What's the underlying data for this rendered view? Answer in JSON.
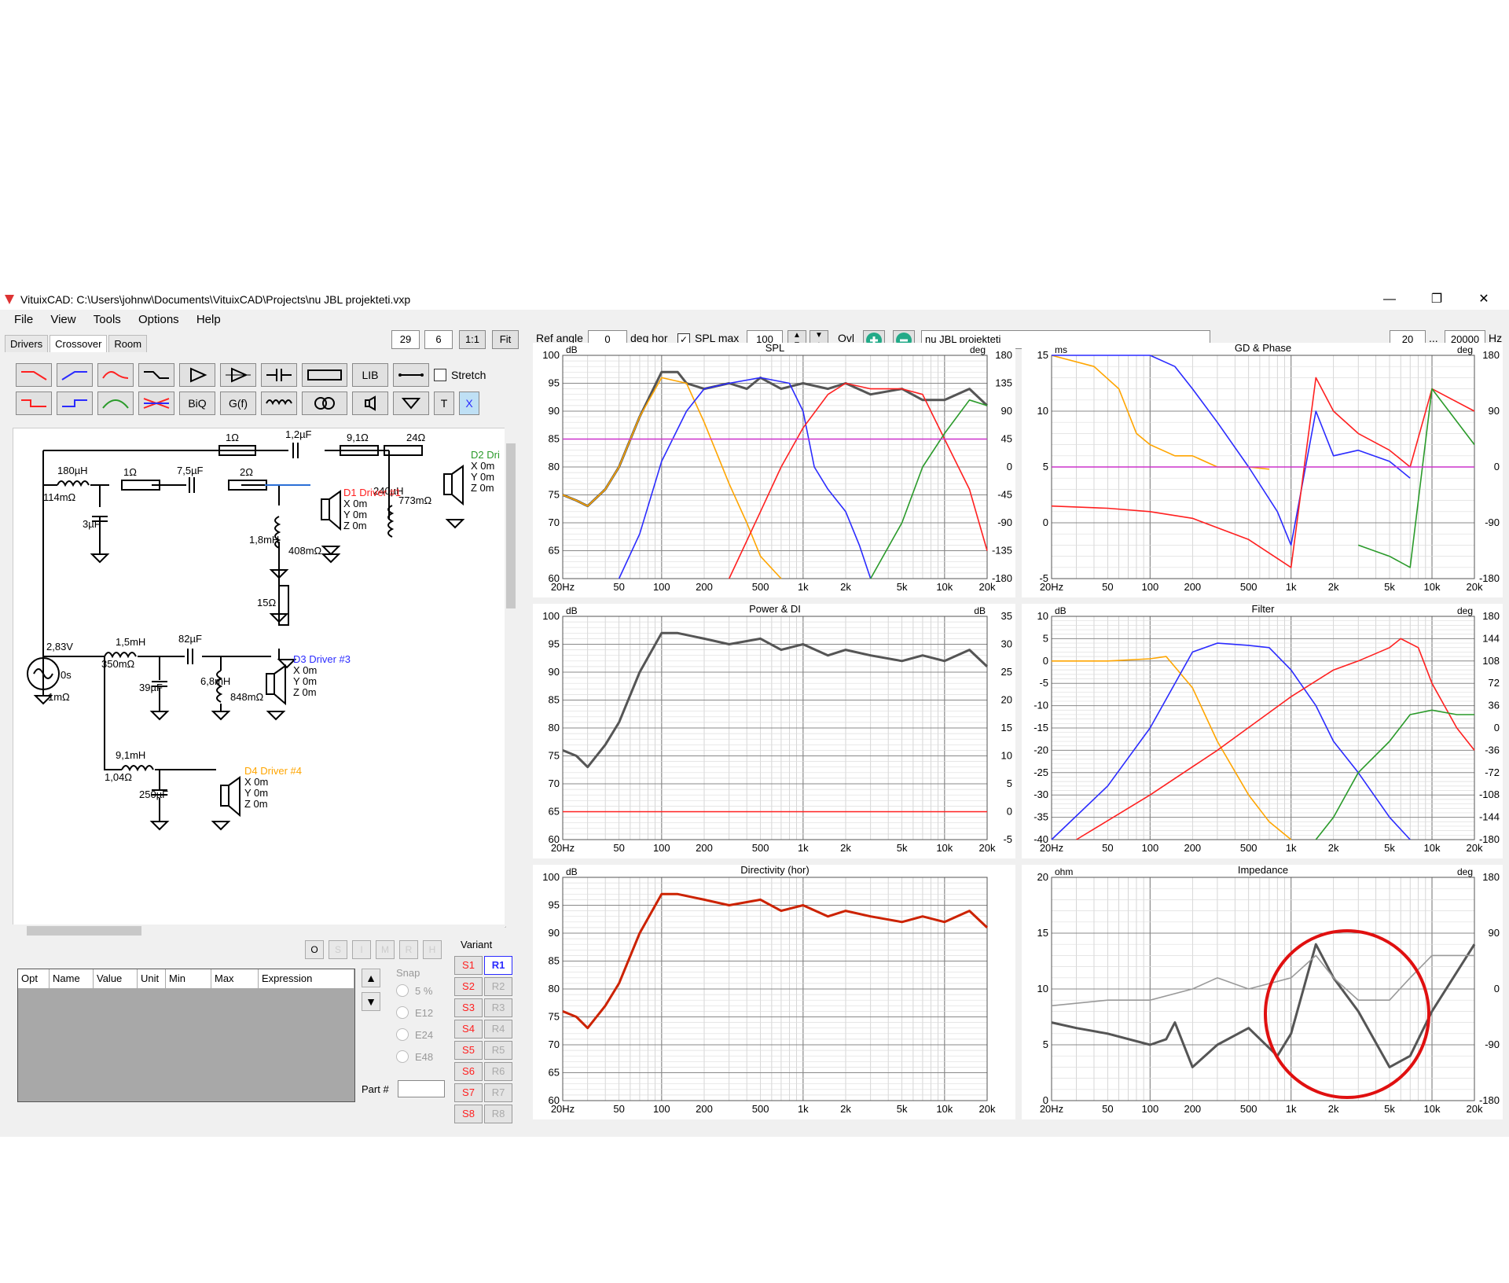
{
  "window": {
    "title": "VituixCAD: C:\\Users\\johnw\\Documents\\VituixCAD\\Projects\\nu JBL projekteti.vxp",
    "minimize": "—",
    "restore": "❐",
    "close": "✕"
  },
  "menu": {
    "file": "File",
    "view": "View",
    "tools": "Tools",
    "options": "Options",
    "help": "Help"
  },
  "tabs": {
    "drivers": "Drivers",
    "crossover": "Crossover",
    "room": "Room"
  },
  "zoom": {
    "a": "29",
    "b": "6",
    "one": "1:1",
    "fit": "Fit"
  },
  "toolbar": {
    "lib": "LIB",
    "biq": "BiQ",
    "gf": "G(f)",
    "t": "T",
    "x": "X",
    "stretch": "Stretch"
  },
  "top_controls": {
    "ref_angle_label": "Ref angle",
    "ref_angle_value": "0",
    "deg_hor": "deg hor",
    "spl_max_label": "SPL max",
    "spl_max_value": "100",
    "ovl": "Ovl",
    "project_name": "nu JBL projekteti",
    "freq_min": "20",
    "ellipsis": "...",
    "freq_max": "20000",
    "hz": "Hz"
  },
  "schematic": {
    "r_top1": "1Ω",
    "c_top": "1,2µF",
    "r_top2": "9,1Ω",
    "r_top3": "24Ω",
    "d2": "D2 Dri",
    "d2x": "X 0m",
    "d2y": "Y 0m",
    "d2z": "Z 0m",
    "l1": "180µH",
    "l1r": "114mΩ",
    "r1": "1Ω",
    "c1": "7,5µF",
    "r2": "2Ω",
    "lp": "240µH",
    "lpr": "773mΩ",
    "c3": "3µF",
    "d1": "D1 Driver #1",
    "d1x": "X 0m",
    "d1y": "Y 0m",
    "d1z": "Z 0m",
    "l2": "1,8mH",
    "l2r": "408mΩ",
    "r15": "15Ω",
    "src_v": "2,83V",
    "src_t": "0s",
    "src_r": "1mΩ",
    "l3": "1,5mH",
    "l3r": "350mΩ",
    "c82": "82µF",
    "c39": "39µF",
    "l4": "6,8mH",
    "l4r": "848mΩ",
    "d3": "D3 Driver #3",
    "d3x": "X 0m",
    "d3y": "Y 0m",
    "d3z": "Z 0m",
    "l5": "9,1mH",
    "l5r": "1,04Ω",
    "c250": "250µF",
    "d4": "D4 Driver #4",
    "d4x": "X 0m",
    "d4y": "Y 0m",
    "d4z": "Z 0m"
  },
  "opt_buttons": [
    "O",
    "S",
    "I",
    "M",
    "R",
    "H"
  ],
  "opt_table": {
    "headers": [
      "Opt",
      "Name",
      "Value",
      "Unit",
      "Min",
      "Max",
      "Expression"
    ]
  },
  "snap": {
    "label": "Snap",
    "options": [
      "5 %",
      "E12",
      "E24",
      "E48"
    ],
    "part_label": "Part #"
  },
  "variant": {
    "label": "Variant",
    "s": [
      "S1",
      "S2",
      "S3",
      "S4",
      "S5",
      "S6",
      "S7",
      "S8"
    ],
    "r": [
      "R1",
      "R2",
      "R3",
      "R4",
      "R5",
      "R6",
      "R7",
      "R8"
    ]
  },
  "colors": {
    "orange": "#ffa500",
    "blue": "#2b2bff",
    "red": "#ff2020",
    "green": "#2a9a2a",
    "magenta": "#cc33cc",
    "dark": "#555555",
    "darkred": "#cc2200"
  },
  "freq_ticks": [
    "20Hz",
    "50",
    "100",
    "200",
    "500",
    "1k",
    "2k",
    "5k",
    "10k",
    "20k"
  ],
  "charts": {
    "spl": {
      "title": "SPL",
      "left_unit": "dB",
      "right_unit": "deg",
      "left_ticks": [
        "100",
        "95",
        "90",
        "85",
        "80",
        "75",
        "70",
        "65",
        "60"
      ],
      "right_ticks": [
        "180",
        "135",
        "90",
        "45",
        "0",
        "-45",
        "-90",
        "-135",
        "-180"
      ]
    },
    "gd": {
      "title": "GD & Phase",
      "left_unit": "ms",
      "right_unit": "deg",
      "left_ticks": [
        "15",
        "10",
        "5",
        "0",
        "-5"
      ],
      "right_ticks": [
        "180",
        "90",
        "0",
        "-90",
        "-180"
      ]
    },
    "power": {
      "title": "Power & DI",
      "left_unit": "dB",
      "right_unit": "dB",
      "left_ticks": [
        "100",
        "95",
        "90",
        "85",
        "80",
        "75",
        "70",
        "65",
        "60"
      ],
      "right_ticks": [
        "35",
        "30",
        "25",
        "20",
        "15",
        "10",
        "5",
        "0",
        "-5"
      ]
    },
    "filter": {
      "title": "Filter",
      "left_unit": "dB",
      "right_unit": "deg",
      "left_ticks": [
        "10",
        "5",
        "0",
        "-5",
        "-10",
        "-15",
        "-20",
        "-25",
        "-30",
        "-35",
        "-40"
      ],
      "right_ticks": [
        "180",
        "144",
        "108",
        "72",
        "36",
        "0",
        "-36",
        "-72",
        "-108",
        "-144",
        "-180"
      ]
    },
    "directivity": {
      "title": "Directivity (hor)",
      "left_unit": "dB",
      "right_unit": "",
      "left_ticks": [
        "100",
        "95",
        "90",
        "85",
        "80",
        "75",
        "70",
        "65",
        "60"
      ],
      "right_ticks": []
    },
    "impedance": {
      "title": "Impedance",
      "left_unit": "ohm",
      "right_unit": "deg",
      "left_ticks": [
        "20",
        "15",
        "10",
        "5",
        "0"
      ],
      "right_ticks": [
        "180",
        "90",
        "0",
        "-90",
        "-180"
      ]
    }
  },
  "chart_data": [
    {
      "type": "line",
      "title": "SPL",
      "xlabel": "",
      "ylabel": "dB",
      "xscale": "log",
      "xlim": [
        20,
        20000
      ],
      "ylim": [
        60,
        100
      ],
      "series": [
        {
          "color": "#555555",
          "x": [
            20,
            25,
            30,
            40,
            50,
            70,
            100,
            130,
            150,
            200,
            300,
            400,
            500,
            700,
            1000,
            1500,
            2000,
            3000,
            5000,
            7000,
            10000,
            15000,
            20000
          ],
          "y": [
            75,
            74,
            73,
            76,
            80,
            89,
            97,
            97,
            95,
            94,
            95,
            94,
            96,
            94,
            95,
            94,
            95,
            93,
            94,
            92,
            92,
            94,
            91
          ]
        },
        {
          "color": "#ffa500",
          "x": [
            20,
            25,
            30,
            40,
            50,
            70,
            100,
            150,
            200,
            300,
            400,
            500,
            700
          ],
          "y": [
            75,
            74,
            73,
            76,
            80,
            89,
            96,
            95,
            88,
            77,
            70,
            64,
            60
          ]
        },
        {
          "color": "#2b2bff",
          "x": [
            50,
            70,
            100,
            150,
            200,
            300,
            500,
            800,
            1000,
            1200,
            1500,
            2000,
            2500,
            3000
          ],
          "y": [
            60,
            68,
            81,
            90,
            94,
            95,
            96,
            95,
            90,
            80,
            76,
            72,
            66,
            60
          ]
        },
        {
          "color": "#ff2020",
          "x": [
            300,
            500,
            700,
            1000,
            1500,
            2000,
            3000,
            5000,
            7000,
            10000,
            15000,
            20000
          ],
          "y": [
            60,
            72,
            80,
            87,
            93,
            95,
            94,
            94,
            93,
            85,
            76,
            65
          ]
        },
        {
          "color": "#2a9a2a",
          "x": [
            3000,
            5000,
            7000,
            10000,
            15000,
            20000
          ],
          "y": [
            60,
            70,
            80,
            86,
            92,
            91
          ]
        },
        {
          "color": "#cc33cc",
          "x": [
            20,
            20000
          ],
          "y": [
            85,
            85
          ]
        }
      ]
    },
    {
      "type": "line",
      "title": "Power & DI",
      "xlabel": "",
      "ylabel": "dB",
      "xscale": "log",
      "xlim": [
        20,
        20000
      ],
      "ylim": [
        60,
        100
      ],
      "series": [
        {
          "color": "#555555",
          "x": [
            20,
            25,
            30,
            40,
            50,
            70,
            100,
            130,
            200,
            300,
            500,
            700,
            1000,
            1500,
            2000,
            3000,
            5000,
            7000,
            10000,
            15000,
            20000
          ],
          "y": [
            76,
            75,
            73,
            77,
            81,
            90,
            97,
            97,
            96,
            95,
            96,
            94,
            95,
            93,
            94,
            93,
            92,
            93,
            92,
            94,
            91
          ]
        },
        {
          "color": "#ff2020",
          "x": [
            20,
            20000
          ],
          "y": [
            65,
            65
          ]
        }
      ]
    },
    {
      "type": "line",
      "title": "Directivity (hor)",
      "xlabel": "",
      "ylabel": "dB",
      "xscale": "log",
      "xlim": [
        20,
        20000
      ],
      "ylim": [
        60,
        100
      ],
      "series": [
        {
          "color": "#cc2200",
          "x": [
            20,
            25,
            30,
            40,
            50,
            70,
            100,
            130,
            200,
            300,
            500,
            700,
            1000,
            1500,
            2000,
            3000,
            5000,
            7000,
            10000,
            15000,
            20000
          ],
          "y": [
            76,
            75,
            73,
            77,
            81,
            90,
            97,
            97,
            96,
            95,
            96,
            94,
            95,
            93,
            94,
            93,
            92,
            93,
            92,
            94,
            91
          ]
        }
      ]
    },
    {
      "type": "line",
      "title": "GD & Phase",
      "xlabel": "",
      "ylabel": "ms",
      "xscale": "log",
      "xlim": [
        20,
        20000
      ],
      "ylim": [
        -5,
        15
      ],
      "series": [
        {
          "color": "#ffa500",
          "x": [
            20,
            40,
            60,
            80,
            100,
            150,
            200,
            300,
            500,
            700
          ],
          "y": [
            15,
            14,
            12,
            8,
            7,
            6,
            6,
            5,
            5,
            4.8
          ]
        },
        {
          "color": "#2b2bff",
          "x": [
            20,
            100,
            150,
            200,
            300,
            500,
            800,
            1000,
            1500,
            2000,
            3000,
            5000,
            7000
          ],
          "y": [
            15,
            15,
            14,
            12,
            9,
            5,
            1,
            -2,
            10,
            6,
            6.5,
            5.5,
            4
          ]
        },
        {
          "color": "#ff2020",
          "x": [
            20,
            50,
            100,
            200,
            500,
            1000,
            1500,
            2000,
            3000,
            5000,
            7000,
            10000,
            20000
          ],
          "y": [
            1.5,
            1.3,
            1,
            0.4,
            -1.5,
            -4,
            13,
            10,
            8,
            6.5,
            5,
            12,
            10
          ]
        },
        {
          "color": "#2a9a2a",
          "x": [
            3000,
            5000,
            7000,
            10000,
            20000
          ],
          "y": [
            -2,
            -3,
            -4,
            12,
            7
          ]
        },
        {
          "color": "#cc33cc",
          "x": [
            20,
            20000
          ],
          "y": [
            5,
            5
          ]
        }
      ]
    },
    {
      "type": "line",
      "title": "Filter",
      "xlabel": "",
      "ylabel": "dB",
      "xscale": "log",
      "xlim": [
        20,
        20000
      ],
      "ylim": [
        -40,
        10
      ],
      "series": [
        {
          "color": "#ffa500",
          "x": [
            20,
            50,
            100,
            130,
            200,
            300,
            500,
            700,
            1000
          ],
          "y": [
            0,
            0,
            0.5,
            1,
            -6,
            -18,
            -30,
            -36,
            -40
          ]
        },
        {
          "color": "#2b2bff",
          "x": [
            20,
            50,
            100,
            200,
            300,
            500,
            700,
            1000,
            1500,
            2000,
            3000,
            5000,
            7000
          ],
          "y": [
            -40,
            -28,
            -15,
            2,
            4,
            3.5,
            3,
            -2,
            -10,
            -18,
            -25,
            -35,
            -40
          ]
        },
        {
          "color": "#ff2020",
          "x": [
            30,
            100,
            300,
            1000,
            2000,
            3000,
            5000,
            6000,
            8000,
            10000,
            15000,
            20000
          ],
          "y": [
            -40,
            -30,
            -20,
            -8,
            -2,
            0,
            3,
            5,
            3,
            -5,
            -15,
            -20
          ]
        },
        {
          "color": "#2a9a2a",
          "x": [
            1500,
            2000,
            3000,
            5000,
            7000,
            10000,
            15000,
            20000
          ],
          "y": [
            -40,
            -35,
            -25,
            -18,
            -12,
            -11,
            -12,
            -12
          ]
        }
      ]
    },
    {
      "type": "line",
      "title": "Impedance",
      "xlabel": "",
      "ylabel": "ohm",
      "xscale": "log",
      "xlim": [
        20,
        20000
      ],
      "ylim": [
        0,
        20
      ],
      "series": [
        {
          "color": "#555555",
          "x": [
            20,
            30,
            50,
            100,
            130,
            150,
            200,
            300,
            500,
            800,
            1000,
            1500,
            2000,
            3000,
            5000,
            7000,
            10000,
            20000
          ],
          "y": [
            7,
            6.5,
            6,
            5,
            5.5,
            7,
            3,
            5,
            6.5,
            4,
            6,
            14,
            11,
            8,
            3,
            4,
            8,
            14
          ]
        },
        {
          "color": "#999999",
          "x": [
            20,
            50,
            100,
            200,
            300,
            500,
            1000,
            1500,
            2000,
            3000,
            5000,
            7000,
            10000,
            20000
          ],
          "y": [
            8.5,
            9,
            9,
            10,
            11,
            10,
            11,
            13,
            11,
            9,
            9,
            11,
            13,
            13
          ]
        }
      ]
    }
  ]
}
